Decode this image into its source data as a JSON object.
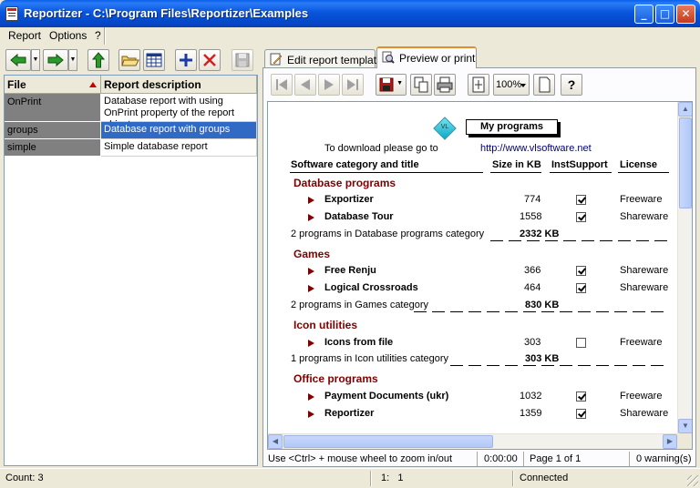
{
  "window": {
    "title": "Reportizer - C:\\Program Files\\Reportizer\\Examples",
    "min_glyph": "_",
    "max_glyph": "□",
    "close_glyph": "✕"
  },
  "menu": {
    "items": [
      "Report",
      "Options",
      "?"
    ]
  },
  "left_toolbar": {
    "buttons": [
      "back-arrow-icon",
      "forward-arrow-icon",
      "up-arrow-icon",
      "open-folder-icon",
      "grid-view-icon",
      "add-icon",
      "delete-icon",
      "save-icon"
    ]
  },
  "grid": {
    "columns": [
      "File",
      "Report description"
    ],
    "rows": [
      {
        "file": "OnPrint",
        "desc": "Database report with using OnPrint property of the report objects"
      },
      {
        "file": "groups",
        "desc": "Database report with groups"
      },
      {
        "file": "simple",
        "desc": "Simple database report"
      }
    ]
  },
  "tabs": [
    "Edit report template",
    "Preview or print"
  ],
  "preview_toolbar": {
    "zoom": "100%",
    "help": "?"
  },
  "report": {
    "logo_text": "VL",
    "title": "My programs",
    "download_text": "To download please go to",
    "url": "http://www.vlsoftware.net",
    "headers": [
      "Software category and title",
      "Size in KB",
      "InstSupport",
      "License"
    ],
    "groups": [
      {
        "name": "Database programs",
        "items": [
          {
            "title": "Exportizer",
            "size": "774",
            "inst": true,
            "license": "Freeware"
          },
          {
            "title": "Database Tour",
            "size": "1558",
            "inst": true,
            "license": "Shareware"
          }
        ],
        "summary": "2 programs in Database programs category",
        "total": "2332 KB"
      },
      {
        "name": "Games",
        "items": [
          {
            "title": "Free Renju",
            "size": "366",
            "inst": true,
            "license": "Shareware"
          },
          {
            "title": "Logical Crossroads",
            "size": "464",
            "inst": true,
            "license": "Shareware"
          }
        ],
        "summary": "2 programs in Games category",
        "total": "830 KB"
      },
      {
        "name": "Icon utilities",
        "items": [
          {
            "title": "Icons from file",
            "size": "303",
            "inst": false,
            "license": "Freeware"
          }
        ],
        "summary": "1 programs in Icon utilities category",
        "total": "303 KB"
      },
      {
        "name": "Office programs",
        "items": [
          {
            "title": "Payment Documents (ukr)",
            "size": "1032",
            "inst": true,
            "license": "Freeware"
          },
          {
            "title": "Reportizer",
            "size": "1359",
            "inst": true,
            "license": "Shareware"
          }
        ],
        "summary": "",
        "total": ""
      }
    ]
  },
  "preview_status": {
    "hint": "Use <Ctrl> + mouse wheel to zoom in/out",
    "time": "0:00:00",
    "page": "Page 1 of 1",
    "warnings": "0 warning(s)"
  },
  "statusbar": {
    "count": "Count: 3",
    "position": "1:   1",
    "connection": "Connected"
  }
}
